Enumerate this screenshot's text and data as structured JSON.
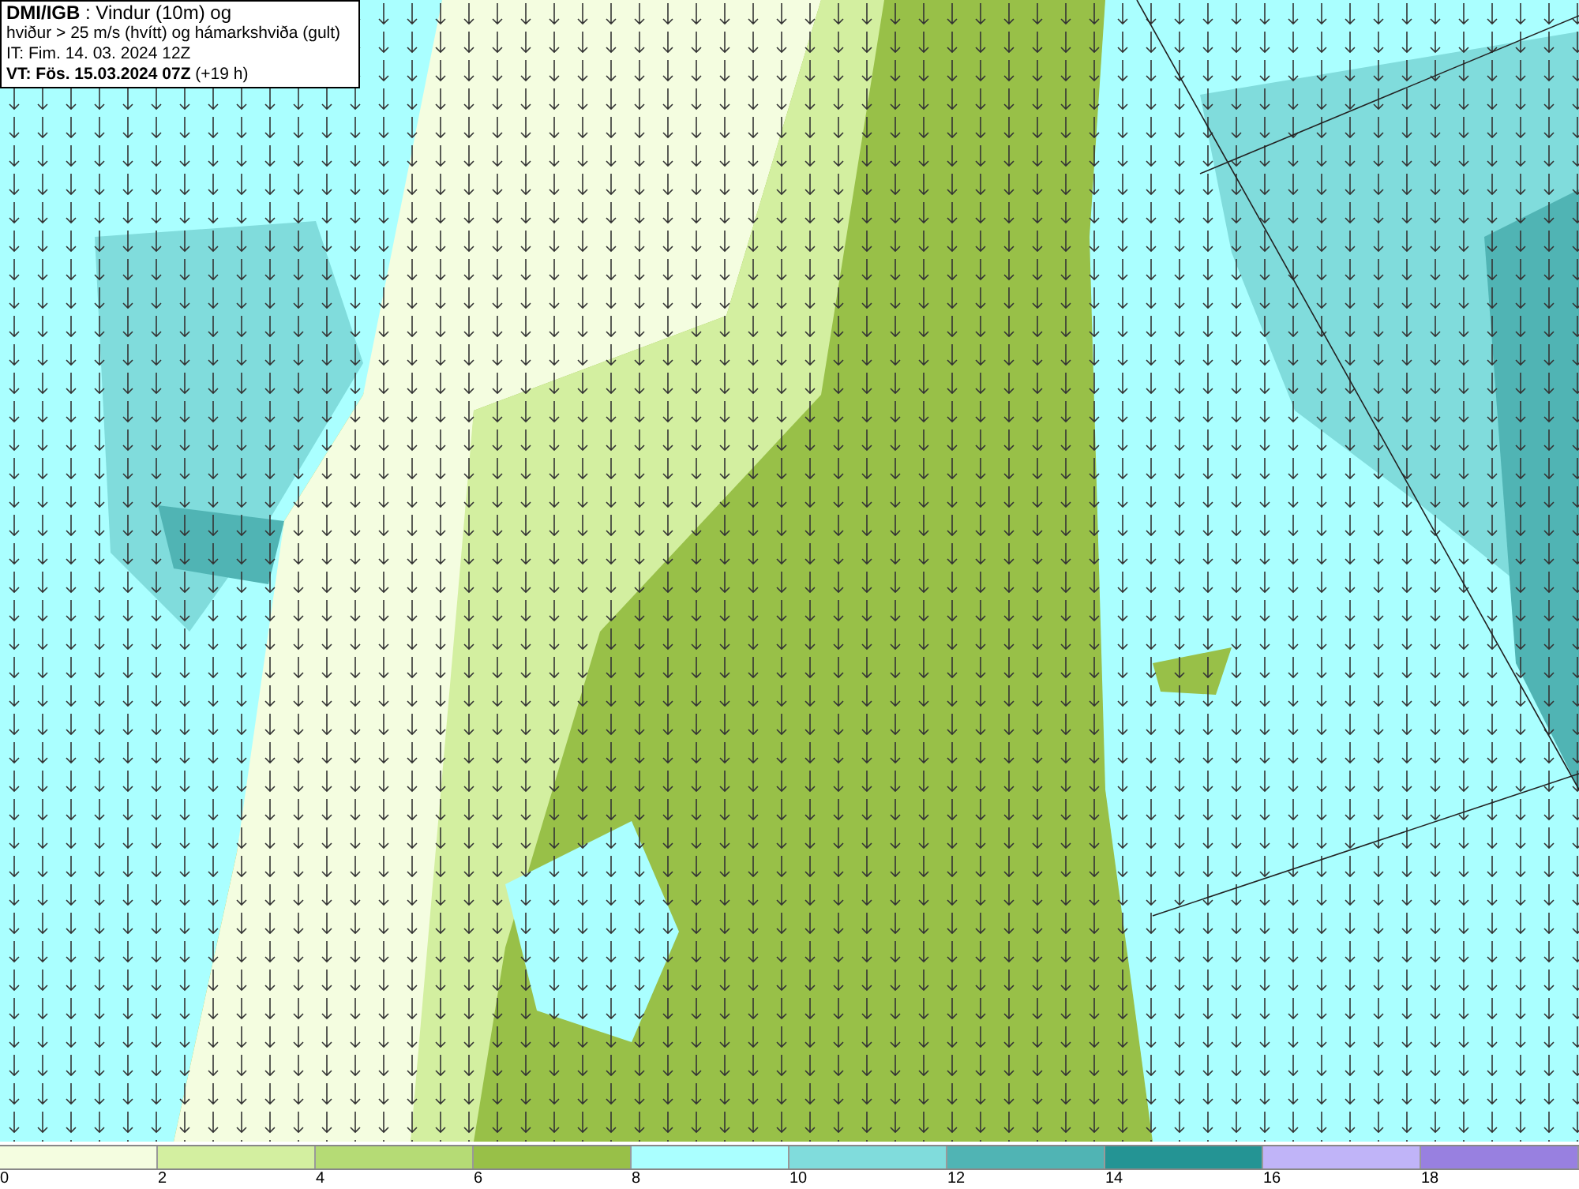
{
  "title_box": {
    "lines": [
      "**DMI/IGB** : Vindur (10m) og",
      "hviður > 25 m/s (hvítt) og hámarkshviða (gult)",
      "IT: Fim. 14. 03. 2024 12Z",
      "**VT: Fös. 15.03.2024 07Z** (+19 h)"
    ]
  },
  "legend": {
    "bins": [
      {
        "color": "#f4fde0"
      },
      {
        "color": "#d3efa0"
      },
      {
        "color": "#b5db75"
      },
      {
        "color": "#98c048"
      },
      {
        "color": "#aaffff"
      },
      {
        "color": "#80dcdc"
      },
      {
        "color": "#50b4b4"
      },
      {
        "color": "#249494"
      },
      {
        "color": "#c0b4f8"
      },
      {
        "color": "#9880e0"
      }
    ],
    "ticks": [
      "0",
      "2",
      "4",
      "6",
      "8",
      "10",
      "12",
      "14",
      "16",
      "18"
    ]
  }
}
